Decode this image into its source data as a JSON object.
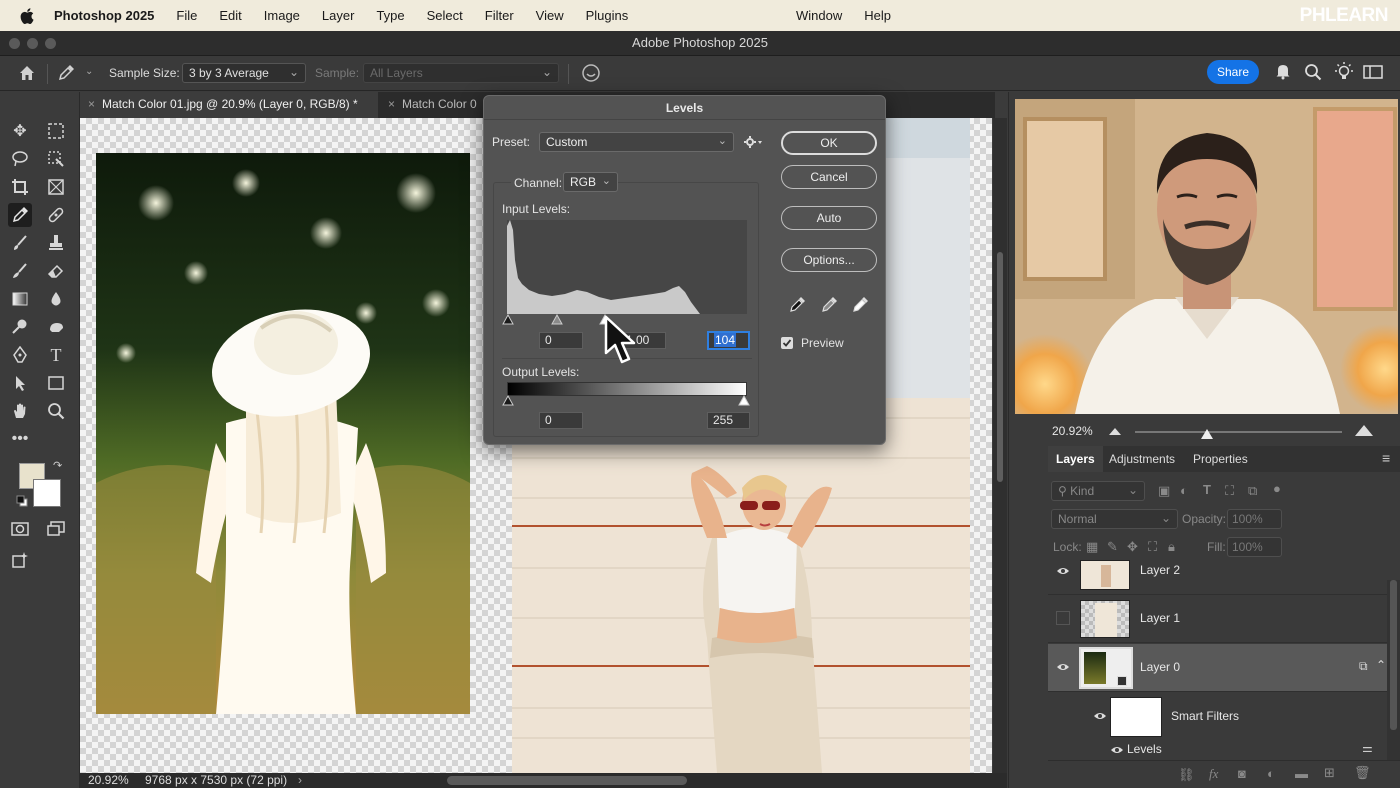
{
  "menubar": {
    "app_name": "Photoshop 2025",
    "items": [
      "File",
      "Edit",
      "Image",
      "Layer",
      "Type",
      "Select",
      "Filter",
      "View",
      "Plugins"
    ],
    "right_items": [
      "Window",
      "Help"
    ],
    "brand": "PHLEARN"
  },
  "window": {
    "title": "Adobe Photoshop 2025"
  },
  "options_bar": {
    "sample_size_label": "Sample Size:",
    "sample_size_value": "3 by 3 Average",
    "sample_label": "Sample:",
    "sample_value": "All Layers",
    "share_label": "Share"
  },
  "tabs": [
    {
      "label": "Match Color 01.jpg @ 20.9% (Layer 0, RGB/8) *",
      "close": "×"
    },
    {
      "label": "Match Color 0",
      "close": "×"
    }
  ],
  "status_bar": {
    "zoom": "20.92%",
    "doc_info": "9768 px x 7530 px (72 ppi)",
    "arrow": "›"
  },
  "levels_dialog": {
    "title": "Levels",
    "preset_label": "Preset:",
    "preset_value": "Custom",
    "channel_label": "Channel:",
    "channel_value": "RGB",
    "input_levels_label": "Input Levels:",
    "input_black": "0",
    "input_gamma": "1.00",
    "input_white": "104",
    "output_levels_label": "Output Levels:",
    "output_black": "0",
    "output_white": "255",
    "buttons": {
      "ok": "OK",
      "cancel": "Cancel",
      "auto": "Auto",
      "options": "Options..."
    },
    "preview_label": "Preview",
    "preview_checked": true
  },
  "navigator": {
    "zoom": "20.92%",
    "zoom_slider_position": 0.35
  },
  "panel_tabs": {
    "layers": "Layers",
    "adjustments": "Adjustments",
    "properties": "Properties"
  },
  "layers_panel": {
    "filter_placeholder": "Kind",
    "blend_mode": "Normal",
    "opacity_label": "Opacity:",
    "opacity_value": "100%",
    "lock_label": "Lock:",
    "fill_label": "Fill:",
    "fill_value": "100%",
    "layers": [
      {
        "name": "Layer 2",
        "visible": true,
        "selected": false
      },
      {
        "name": "Layer 1",
        "visible": false,
        "selected": false
      },
      {
        "name": "Layer 0",
        "visible": true,
        "selected": true
      }
    ],
    "smart_filters_label": "Smart Filters",
    "levels_filter_label": "Levels"
  },
  "colors": {
    "accent": "#1473e6",
    "foreground_swatch": "#e8e2cc",
    "background_swatch": "#ffffff"
  }
}
